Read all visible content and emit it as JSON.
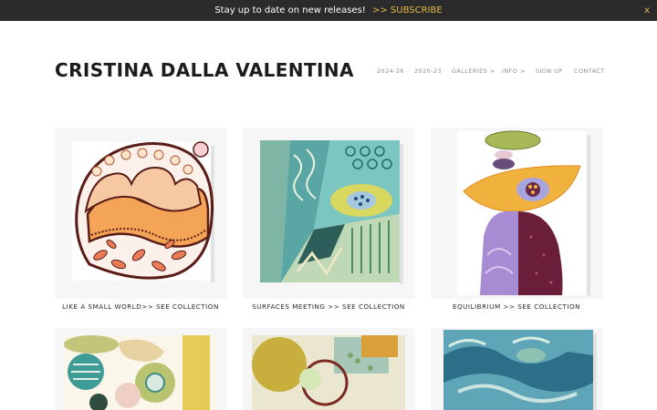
{
  "announcement": {
    "message": "Stay up to date on new releases!",
    "cta": ">> SUBSCRIBE",
    "close": "x"
  },
  "site_title": "CRISTINA DALLA VALENTINA",
  "nav": {
    "items": [
      "2024-26",
      "2020-23",
      "GALLERIES >",
      "INFO >",
      "SIGN UP",
      "CONTACT"
    ]
  },
  "gallery": {
    "captions": [
      "LIKE A SMALL WORLD>> SEE COLLECTION",
      "SURFACES MEETING >> SEE COLLECTION",
      "EQUILIBRIUM >> SEE COLLECTION"
    ]
  },
  "colors": {
    "announce_bg": "#2b2b2b",
    "accent": "#e6b84a",
    "nav_text": "#8d8d8d"
  },
  "icons": {
    "close": "close-icon"
  }
}
